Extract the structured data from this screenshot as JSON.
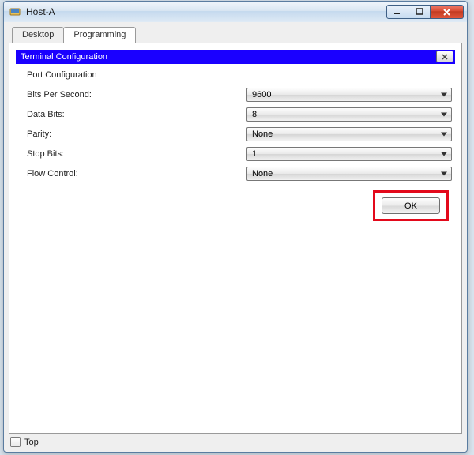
{
  "window": {
    "title": "Host-A"
  },
  "tabs": {
    "tab1": "Desktop",
    "tab2": "Programming"
  },
  "dialog": {
    "title": "Terminal Configuration",
    "section": "Port Configuration",
    "bps": {
      "label": "Bits Per Second:",
      "value": "9600"
    },
    "databits": {
      "label": "Data Bits:",
      "value": "8"
    },
    "parity": {
      "label": "Parity:",
      "value": "None"
    },
    "stopbits": {
      "label": "Stop Bits:",
      "value": "1"
    },
    "flow": {
      "label": "Flow Control:",
      "value": "None"
    },
    "ok": "OK"
  },
  "bottom": {
    "top_checkbox": "Top"
  }
}
